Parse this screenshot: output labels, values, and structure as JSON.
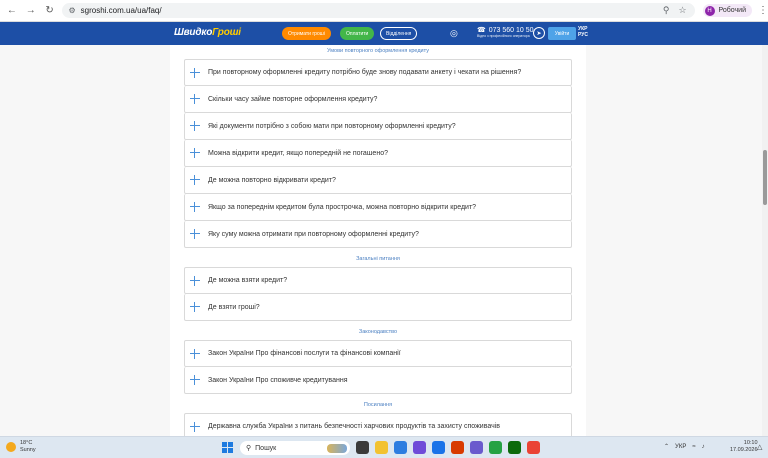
{
  "browser": {
    "url": "sgroshi.com.ua/ua/faq/",
    "profile_initial": "Н",
    "profile_name": "Робочий"
  },
  "header": {
    "logo_part1": "Швидко",
    "logo_part2": "Гроші",
    "get_money": "Отримати гроші",
    "pay": "Оплатити",
    "branches": "Відділення",
    "phone": "073 560 10 50",
    "phone_sub": "Відео з професійного оператора",
    "login": "Увійти",
    "lang_ua": "УКР",
    "lang_ru": "РУС"
  },
  "sections": [
    {
      "title": "Умови повторного оформлення кредиту",
      "items": [
        "При повторному оформленні кредиту потрібно буде знову подавати анкету і чекати на рішення?",
        "Скільки часу займе повторне оформлення кредиту?",
        "Які документи потрібно з собою мати при повторному оформленні кредиту?",
        "Можна відкрити кредит, якщо попередній не погашено?",
        "Де можна повторно відкривати кредит?",
        "Якщо за попереднім кредитом була прострочка, можна повторно відкрити кредит?",
        "Яку суму можна отримати при повторному оформленні кредиту?"
      ]
    },
    {
      "title": "Загальні питання",
      "items": [
        "Де можна взяти кредит?",
        "Де взяти гроші?"
      ]
    },
    {
      "title": "Законодавство",
      "items": [
        "Закон України Про фінансові послуги та фінансові компанії",
        "Закон України Про споживче кредитування"
      ]
    },
    {
      "title": "Посилання",
      "items": [
        "Державна служба України з питань безпечності харчових продуктів та захисту споживачів"
      ]
    }
  ],
  "taskbar": {
    "temp": "18°C",
    "weather": "Sunny",
    "search_placeholder": "Пошук",
    "lang": "УКР",
    "time": "10:10",
    "date": "17.09.2026"
  }
}
